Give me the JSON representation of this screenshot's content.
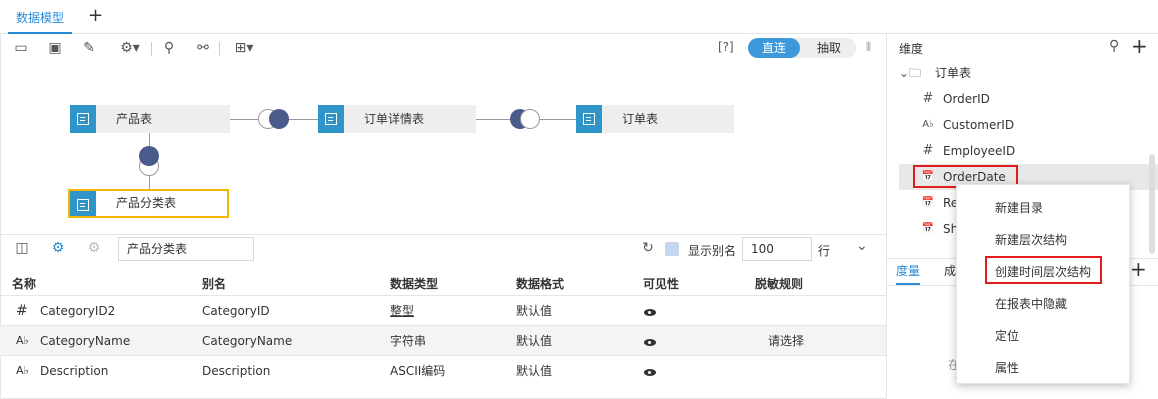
{
  "tabs": {
    "active": "数据模型",
    "add": "+"
  },
  "toolbar": {
    "help": "[?]",
    "mode_direct": "直连",
    "mode_extract": "抽取",
    "more": "⫴"
  },
  "diagram": {
    "tables": [
      "产品表",
      "订单详情表",
      "订单表",
      "产品分类表"
    ]
  },
  "bottom": {
    "table_name": "产品分类表",
    "show_alias_label": "显示别名",
    "rows_value": "100",
    "rows_unit": "行",
    "columns": [
      "名称",
      "别名",
      "数据类型",
      "数据格式",
      "可见性",
      "脱敏规则"
    ],
    "rows": [
      {
        "type_icon": "#",
        "name": "CategoryID2",
        "alias": "CategoryID",
        "dtype": "整型",
        "format": "默认值",
        "mask": ""
      },
      {
        "type_icon": "A♭",
        "name": "CategoryName",
        "alias": "CategoryName",
        "dtype": "字符串",
        "format": "默认值",
        "mask": "请选择"
      },
      {
        "type_icon": "A♭",
        "name": "Description",
        "alias": "Description",
        "dtype": "ASCII编码",
        "format": "默认值",
        "mask": ""
      }
    ]
  },
  "right": {
    "title": "维度",
    "folder": "订单表",
    "items": [
      {
        "glyph": "#",
        "label": "OrderID"
      },
      {
        "glyph": "A♭",
        "label": "CustomerID"
      },
      {
        "glyph": "#",
        "label": "EmployeeID"
      },
      {
        "glyph": "📅",
        "label": "OrderDate"
      },
      {
        "glyph": "📅",
        "label": "Re"
      },
      {
        "glyph": "📅",
        "label": "Sh"
      }
    ],
    "measure_tab": "度量",
    "second_tab": "成",
    "partial_text": "在"
  },
  "context_menu": {
    "items": [
      "新建目录",
      "新建层次结构",
      "创建时间层次结构",
      "在报表中隐藏",
      "定位",
      "属性"
    ]
  },
  "colors": {
    "accent": "#2a8bd6",
    "table_icon": "#2f95c9",
    "highlight": "#e21b1b"
  }
}
